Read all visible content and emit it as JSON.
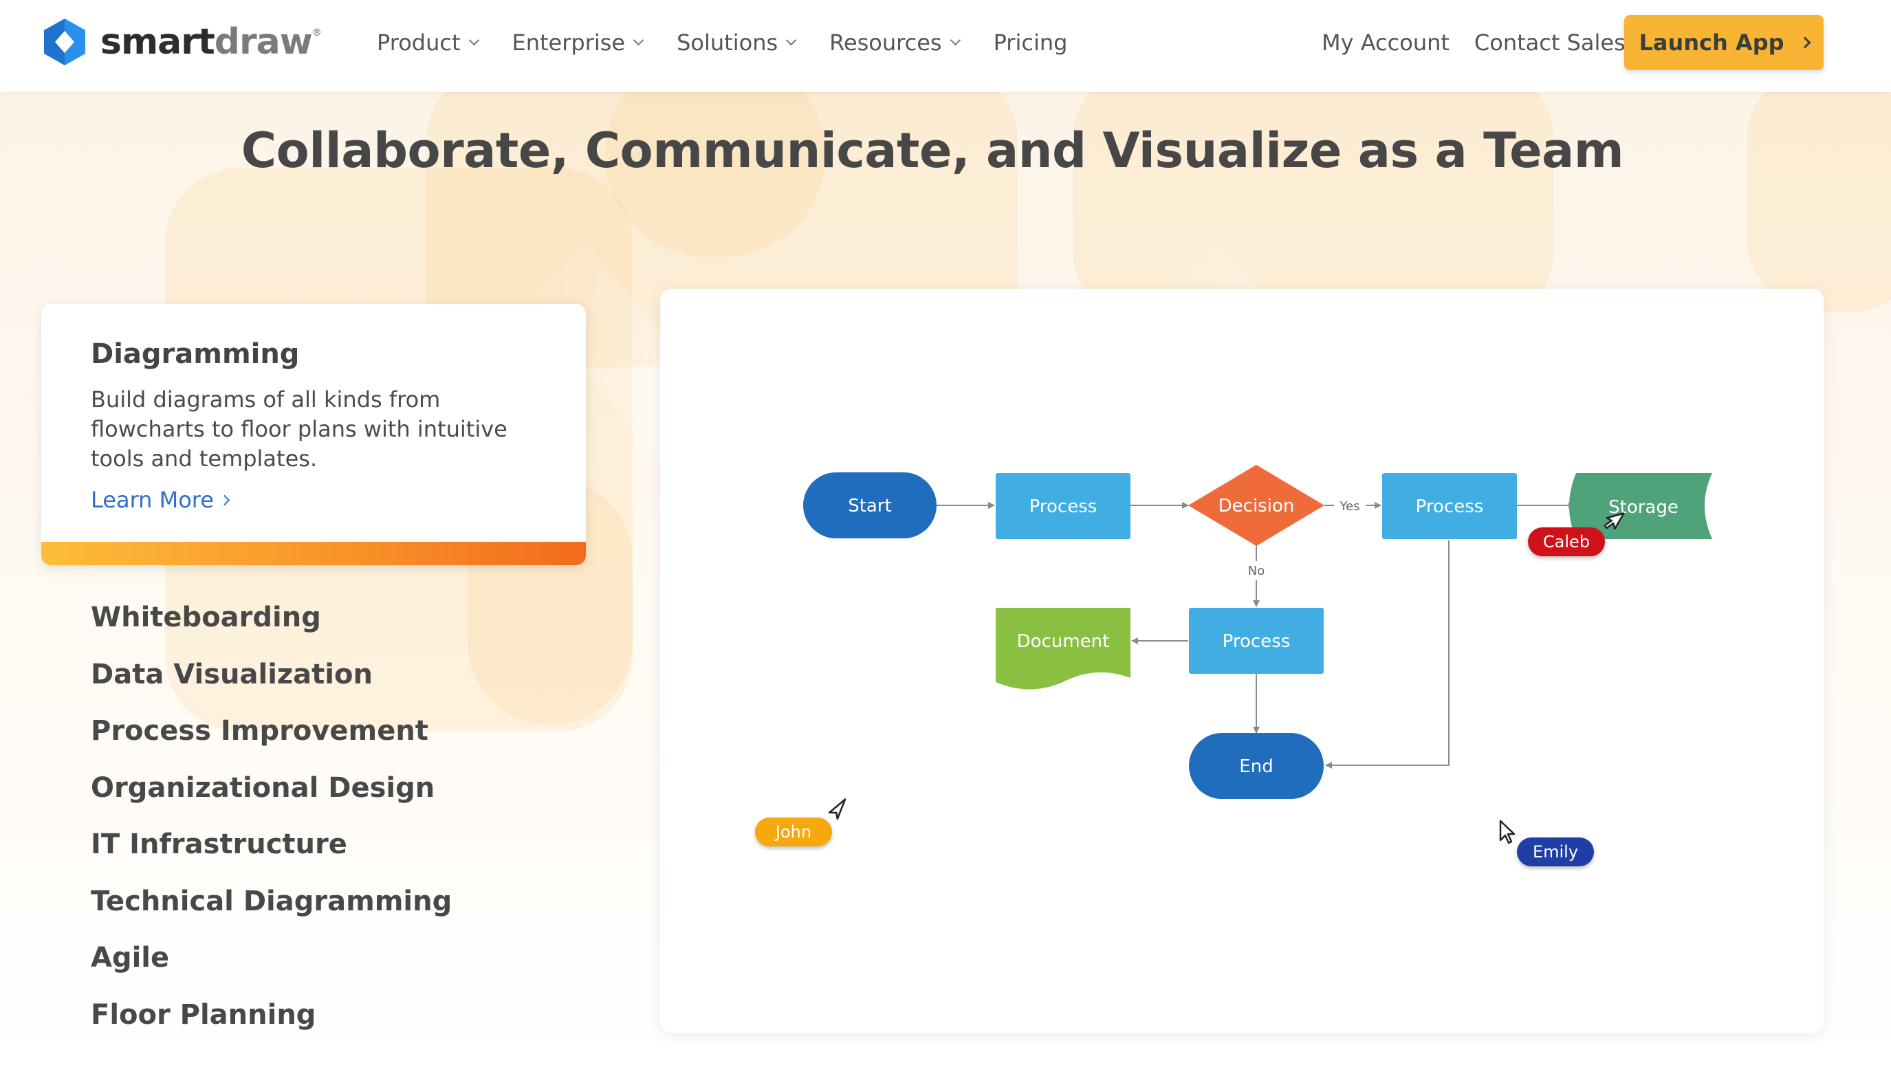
{
  "logo": {
    "part1": "smart",
    "part2": "draw",
    "mark": "®"
  },
  "nav": [
    {
      "label": "Product",
      "has_menu": true
    },
    {
      "label": "Enterprise",
      "has_menu": true
    },
    {
      "label": "Solutions",
      "has_menu": true
    },
    {
      "label": "Resources",
      "has_menu": true
    },
    {
      "label": "Pricing",
      "has_menu": false
    }
  ],
  "right_nav": {
    "account": "My Account",
    "contact": "Contact Sales",
    "launch": "Launch App"
  },
  "hero": {
    "title": "Collaborate, Communicate, and Visualize as a Team"
  },
  "active_feature": {
    "title": "Diagramming",
    "description": "Build diagrams of all kinds from flowcharts to floor plans with intuitive tools and templates.",
    "link": "Learn More"
  },
  "features": [
    "Whiteboarding",
    "Data Visualization",
    "Process Improvement",
    "Organizational Design",
    "IT Infrastructure",
    "Technical Diagramming",
    "Agile",
    "Floor Planning"
  ],
  "diagram": {
    "nodes": {
      "start": "Start",
      "process1": "Process",
      "decision": "Decision",
      "process2": "Process",
      "storage": "Storage",
      "process3": "Process",
      "document": "Document",
      "end": "End"
    },
    "edge_labels": {
      "yes": "Yes",
      "no": "No"
    }
  },
  "collaborators": [
    {
      "name": "Caleb",
      "color": "#d0111a"
    },
    {
      "name": "John",
      "color": "#f6a90f"
    },
    {
      "name": "Emily",
      "color": "#1f3fa6"
    }
  ],
  "colors": {
    "accent": "#f8b533",
    "terminal_blue": "#1f6dbc",
    "process_blue": "#40aee2",
    "decision_orange": "#ef6b3a",
    "document_green": "#8ac042",
    "storage_green": "#4fa37a",
    "link_blue": "#2f6fc6"
  },
  "icons": {
    "logo": "smartdraw-logo-icon",
    "chevron": "chevron-down-icon",
    "arrow": "chevron-right-icon",
    "cursor": "mouse-pointer-icon"
  }
}
